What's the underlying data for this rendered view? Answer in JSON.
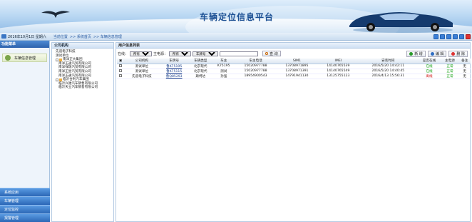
{
  "header": {
    "title": "车辆定位信息平台"
  },
  "toolbar": {
    "date": "2016年10月1日 星期六",
    "crumbs": [
      "当前位置",
      ">> 系统首页",
      ">> 车辆信息管理"
    ]
  },
  "left": {
    "head": "功能菜单",
    "item": "车辆信息管理",
    "bottom": [
      "系统应用",
      "车辆管理",
      "定位监控",
      "报警管理"
    ]
  },
  "tree": {
    "head": "公司机构",
    "nodes": [
      {
        "label": "先道电子科技",
        "level": 1
      },
      {
        "label": "测试单位",
        "level": 1
      },
      {
        "label": "南洋正大集团",
        "level": 1,
        "folder": true
      },
      {
        "label": "南洋正通汽贸有限公司",
        "level": 2
      },
      {
        "label": "南洋祥瑞汽贸有限公司",
        "level": 2
      },
      {
        "label": "南洋正星汽贸有限公司",
        "level": 2
      },
      {
        "label": "南洋正通汽贸有限公司",
        "level": 2
      },
      {
        "label": "临沂合利汽车集团",
        "level": 1,
        "folder": true
      },
      {
        "label": "临沂兴驰汽车销售有限公司",
        "level": 2
      },
      {
        "label": "临沂天立汽车销售有限公司",
        "level": 2
      }
    ]
  },
  "main": {
    "head": "用户信息列表",
    "filter": {
      "online_label": "在线：",
      "online_value": "所有",
      "power_label": "主电源：",
      "power_value": "所有",
      "field_value": "车牌号",
      "search_label": "查 询"
    },
    "actions": {
      "add": "新 增",
      "edit": "编 辑",
      "delete": "删 除"
    },
    "columns": [
      "公司机构",
      "车牌号",
      "车辆类型",
      "车主",
      "车主电话",
      "SIM1",
      "IMEI",
      "安装时间",
      "是否在线",
      "主电源",
      "备注"
    ],
    "rows": [
      [
        "测试单位",
        "鲁K75195",
        "北京现代",
        "K75195",
        "15020977788",
        "13708971895",
        "14140765539",
        "2016/5/20 14:42:11",
        "在线",
        "正常",
        "无"
      ],
      [
        "测试单位",
        "鲁K75115",
        "北京现代",
        "测试",
        "15020977788",
        "13708971391",
        "14140765549",
        "2016/5/20 14:40:45",
        "在线",
        "正常",
        "无"
      ],
      [
        "先道电子科技",
        "鲁Q85293",
        "斯柯达",
        "孙强",
        "18954900543",
        "14791941130",
        "13125755123",
        "2016/4/13 15:56:31",
        "离线",
        "正常",
        "无"
      ]
    ]
  },
  "colors": {
    "online": "#12a012",
    "offline": "#d01010",
    "accent": "#2b67b6"
  }
}
